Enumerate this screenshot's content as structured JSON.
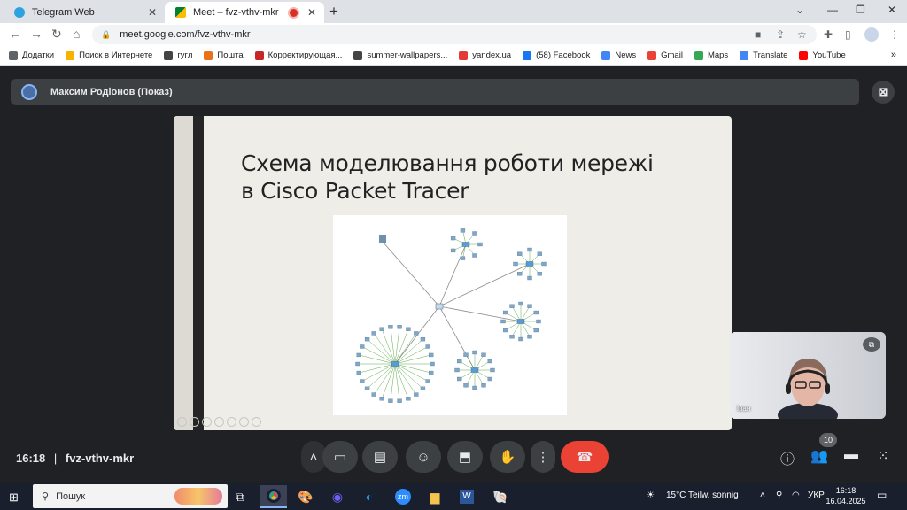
{
  "browser": {
    "tabs": [
      {
        "title": "Telegram Web",
        "close": "✕"
      },
      {
        "title": "Meet – fvz-vthv-mkr",
        "close": "✕"
      }
    ],
    "new_tab": "+",
    "url": "meet.google.com/fvz-vthv-mkr"
  },
  "bookmarks": [
    {
      "label": "Додатки",
      "color": "#5f6368"
    },
    {
      "label": "Поиск в Интернете",
      "color": "#f4b400"
    },
    {
      "label": "гугл",
      "color": "#444444"
    },
    {
      "label": "Пошта",
      "color": "#e8711a"
    },
    {
      "label": "Корректирующая...",
      "color": "#c62828"
    },
    {
      "label": "summer-wallpapers...",
      "color": "#444444"
    },
    {
      "label": "yandex.ua",
      "color": "#e53935"
    },
    {
      "label": "(58) Facebook",
      "color": "#1877f2"
    },
    {
      "label": "News",
      "color": "#4285f4"
    },
    {
      "label": "Gmail",
      "color": "#ea4335"
    },
    {
      "label": "Maps",
      "color": "#34a853"
    },
    {
      "label": "Translate",
      "color": "#4285f4"
    },
    {
      "label": "YouTube",
      "color": "#ff0000"
    }
  ],
  "meet": {
    "presenter": "Максим Родіонов (Показ)",
    "slide_title_line1": "Схема моделювання роботи мережі",
    "slide_title_line2": "в Cisco Packet Tracer",
    "self_name": "Іван",
    "time": "16:18",
    "separator": "|",
    "meeting_code": "fvz-vthv-mkr",
    "participants_count": "10"
  },
  "taskbar": {
    "search_placeholder": "Пошук",
    "weather": "15°C  Teilw. sonnig",
    "lang": "УКР",
    "time": "16:18",
    "date": "16.04.2025"
  }
}
